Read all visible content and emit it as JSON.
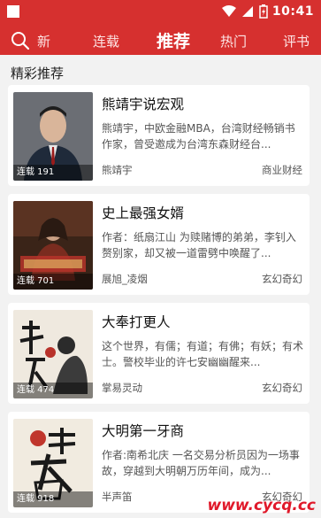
{
  "status_bar": {
    "time": "10:41"
  },
  "nav": {
    "tabs": [
      {
        "label": "新"
      },
      {
        "label": "连载"
      },
      {
        "label": "推荐"
      },
      {
        "label": "热门"
      },
      {
        "label": "评书"
      }
    ],
    "active_tab": "推荐"
  },
  "section": {
    "title": "精彩推荐"
  },
  "books": [
    {
      "title": "熊靖宇说宏观",
      "desc": "熊靖宇，中欧金融MBA，台湾财经畅销书作家，曾受邀成为台湾东森财经台...",
      "author": "熊靖宇",
      "category": "商业财经",
      "badge": "连载 191"
    },
    {
      "title": "史上最强女婿",
      "desc": "作者：纸扇江山 为赎赌博的弟弟，李钊入赘别家，却又被一道雷劈中唤醒了...",
      "author": "展旭_凌烟",
      "category": "玄幻奇幻",
      "badge": "连载 701"
    },
    {
      "title": "大奉打更人",
      "desc": "这个世界，有儒；有道；有佛；有妖；有术士。警校毕业的许七安幽幽醒来...",
      "author": "掌易灵动",
      "category": "玄幻奇幻",
      "badge": "连载 474"
    },
    {
      "title": "大明第一牙商",
      "desc": "作者:南希北庆 一名交易分析员因为一场事故，穿越到大明朝万历年间，成为...",
      "author": "半声笛",
      "category": "玄幻奇幻",
      "badge": "连载 918"
    }
  ],
  "watermark": "www.cycq.cc",
  "colors": {
    "brand_red": "#d6302f",
    "background": "#f2f2f2",
    "watermark_red": "#e0192a"
  }
}
